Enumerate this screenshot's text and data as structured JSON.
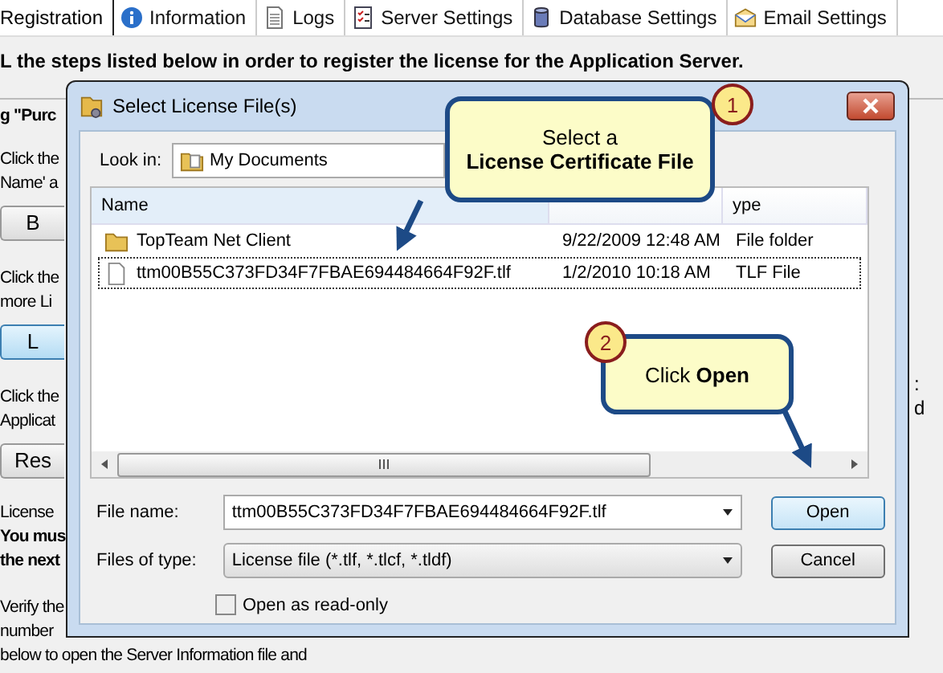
{
  "tabs": [
    {
      "label": "Registration",
      "selected": true
    },
    {
      "label": "Information",
      "selected": false
    },
    {
      "label": "Logs",
      "selected": false
    },
    {
      "label": "Server Settings",
      "selected": false
    },
    {
      "label": "Database Settings",
      "selected": false
    },
    {
      "label": "Email Settings",
      "selected": false
    }
  ],
  "instruction": "L the steps listed below in order to register the license for the Application Server.",
  "sections": [
    {
      "lines": [
        {
          "text": "g \"Purc",
          "bold": true
        }
      ]
    },
    {
      "lines": [
        {
          "text": "Click the",
          "bold": false
        },
        {
          "text": "Name' a",
          "bold": false
        }
      ],
      "button": {
        "label": "B",
        "highlighted": false
      }
    },
    {
      "lines": [
        {
          "text": "Click the",
          "bold": false
        },
        {
          "text": "more Li",
          "bold": false
        }
      ],
      "button": {
        "label": "L",
        "highlighted": true
      }
    },
    {
      "lines": [
        {
          "text": "Click the",
          "bold": false
        },
        {
          "text": "Applicat",
          "bold": false
        }
      ],
      "button": {
        "label": "Res",
        "highlighted": false
      }
    },
    {
      "lines": [
        {
          "text": "License",
          "bold": false
        },
        {
          "text": "You mus",
          "bold": true
        },
        {
          "text": "the next",
          "bold": true
        }
      ]
    },
    {
      "lines": [
        {
          "text": "Verify the",
          "bold": false
        },
        {
          "text": "number",
          "bold": false
        },
        {
          "text": "below to open the Server Information file and",
          "bold": false
        }
      ]
    }
  ],
  "right_fragments": [
    ":",
    "d"
  ],
  "dialog": {
    "title": "Select License File(s)",
    "look_in_label": "Look in:",
    "look_in_value": "My Documents",
    "columns": [
      "Name",
      "ype"
    ],
    "rows": [
      {
        "kind": "folder",
        "name": "TopTeam Net Client",
        "date": "9/22/2009 12:48 AM",
        "type": "File folder",
        "focused": false
      },
      {
        "kind": "file",
        "name": "ttm00B55C373FD34F7FBAE694484664F92F.tlf",
        "date": "1/2/2010 10:18 AM",
        "type": "TLF File",
        "focused": true
      }
    ],
    "file_name_label": "File name:",
    "file_name_value": "ttm00B55C373FD34F7FBAE694484664F92F.tlf",
    "files_of_type_label": "Files of type:",
    "files_of_type_value": "License file (*.tlf, *.tlcf, *.tldf)",
    "read_only": {
      "label": "Open as read-only",
      "checked": false
    },
    "buttons": [
      {
        "label": "Open",
        "default": true
      },
      {
        "label": "Cancel",
        "default": false
      }
    ]
  },
  "callouts": [
    {
      "number": "1",
      "text": "Select a **License Certificate File**"
    },
    {
      "number": "2",
      "text": "Click **Open**"
    }
  ]
}
